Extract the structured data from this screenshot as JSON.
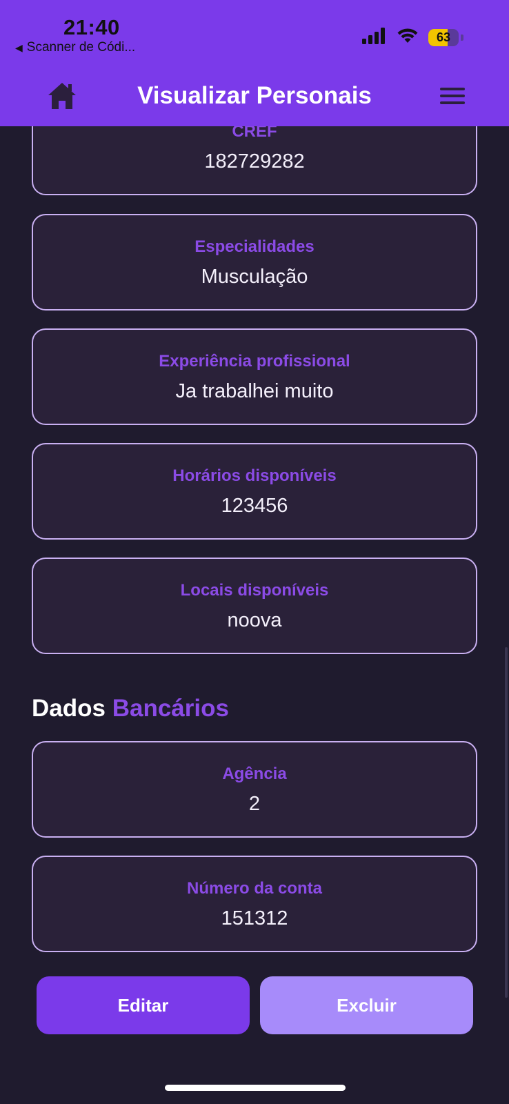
{
  "status_bar": {
    "time": "21:40",
    "back_app": "Scanner de Códi...",
    "battery_level": "63",
    "battery_fraction": 0.63
  },
  "header": {
    "title": "Visualizar Personais",
    "home_icon": "home-icon",
    "menu_icon": "hamburger-menu-icon"
  },
  "fields": [
    {
      "label": "CREF",
      "value": "182729282"
    },
    {
      "label": "Especialidades",
      "value": "Musculação"
    },
    {
      "label": "Experiência profissional",
      "value": "Ja trabalhei muito"
    },
    {
      "label": "Horários disponíveis",
      "value": "123456"
    },
    {
      "label": "Locais disponíveis",
      "value": "noova"
    }
  ],
  "bank_section": {
    "heading_part1": "Dados",
    "heading_part2": "Bancários"
  },
  "bank_fields": [
    {
      "label": "Agência",
      "value": "2"
    },
    {
      "label": "Número da conta",
      "value": "151312"
    }
  ],
  "actions": {
    "edit_label": "Editar",
    "delete_label": "Excluir"
  },
  "colors": {
    "primary": "#7b3aea",
    "accent_text": "#8b4be6",
    "background": "#1f1b2e",
    "card_bg": "#2a2139",
    "card_border": "#c9b0f2",
    "delete_button": "#a78bfa"
  }
}
